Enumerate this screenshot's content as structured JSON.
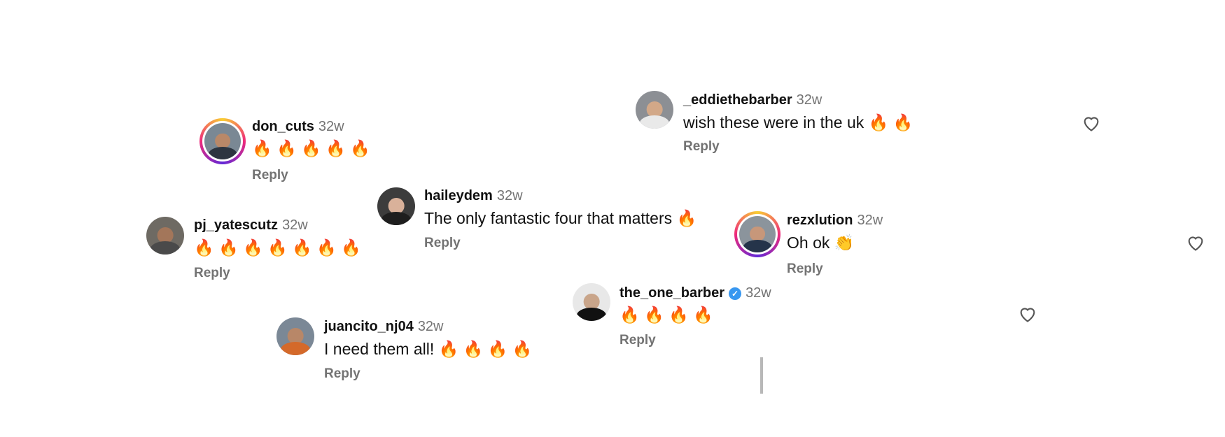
{
  "comments": [
    {
      "username": "_eddiethebarber",
      "time": "32w",
      "text": "wish these were in the uk 🔥 🔥",
      "reply": "Reply"
    },
    {
      "username": "don_cuts",
      "time": "32w",
      "text": "🔥 🔥 🔥 🔥 🔥",
      "reply": "Reply"
    },
    {
      "username": "haileydem",
      "time": "32w",
      "text": "The only fantastic four that matters 🔥",
      "reply": "Reply"
    },
    {
      "username": "pj_yatescutz",
      "time": "32w",
      "text": "🔥 🔥 🔥 🔥 🔥 🔥 🔥",
      "reply": "Reply"
    },
    {
      "username": "rezxlution",
      "time": "32w",
      "text": "Oh ok 👏",
      "reply": "Reply"
    },
    {
      "username": "the_one_barber",
      "time": "32w",
      "text": "🔥 🔥 🔥 🔥",
      "reply": "Reply"
    },
    {
      "username": "juancito_nj04",
      "time": "32w",
      "text": "I need them all! 🔥 🔥 🔥 🔥",
      "reply": "Reply"
    }
  ],
  "icons": {
    "like": "heart-icon",
    "verified": "verified-badge-icon"
  },
  "colors": {
    "secondary_text": "#737373",
    "verified": "#3897f0",
    "story_ring": "#ee2a7b"
  }
}
